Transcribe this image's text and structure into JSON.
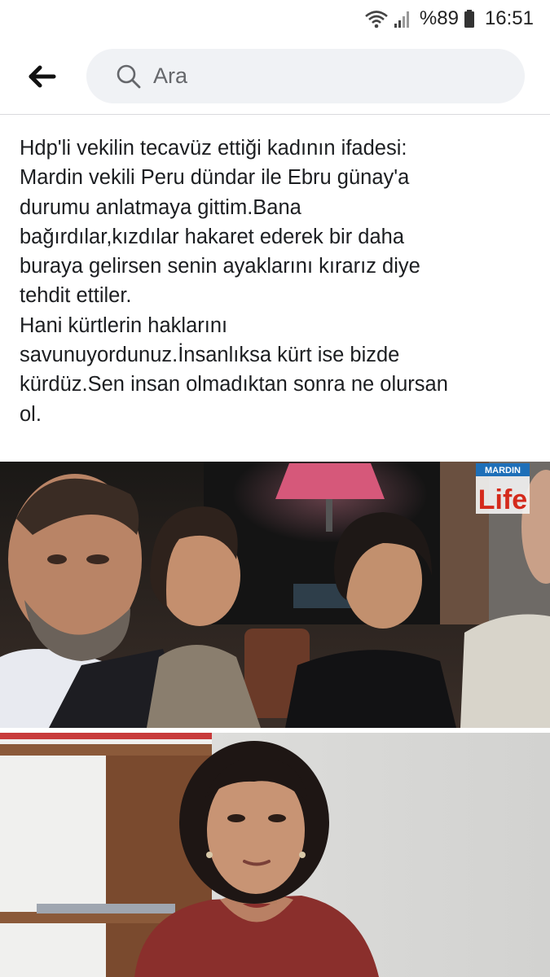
{
  "status_bar": {
    "battery_percent": "%89",
    "time": "16:51",
    "icons": [
      "wifi-icon",
      "signal-icon",
      "battery-icon"
    ]
  },
  "header": {
    "back_icon": "arrow-left-icon",
    "search_icon": "search-icon",
    "search_placeholder": "Ara"
  },
  "post": {
    "lines": [
      "Hdp'li vekilin tecavüz ettiği kadının ifadesi:",
      "Mardin vekili Peru dündar ile Ebru günay'a",
      "durumu anlatmaya gittim.Bana",
      "bağırdılar,kızdılar hakaret ederek bir daha",
      "buraya gelirsen senin ayaklarını kırarız diye",
      "tehdit ettiler.",
      "Hani kürtlerin haklarını",
      "savunuyordunuz.İnsanlıksa kürt ise bizde",
      "kürdüz.Sen insan olmadıktan sonra ne olursan",
      "ol."
    ]
  },
  "photos": [
    {
      "name": "group-photo",
      "watermark_top": "MARDIN",
      "watermark_bottom": "Life"
    },
    {
      "name": "portrait-photo"
    }
  ],
  "colors": {
    "search_bg": "#f0f2f5",
    "text": "#1c1e21",
    "divider": "#d9dadd",
    "watermark_red": "#d42a1c"
  }
}
